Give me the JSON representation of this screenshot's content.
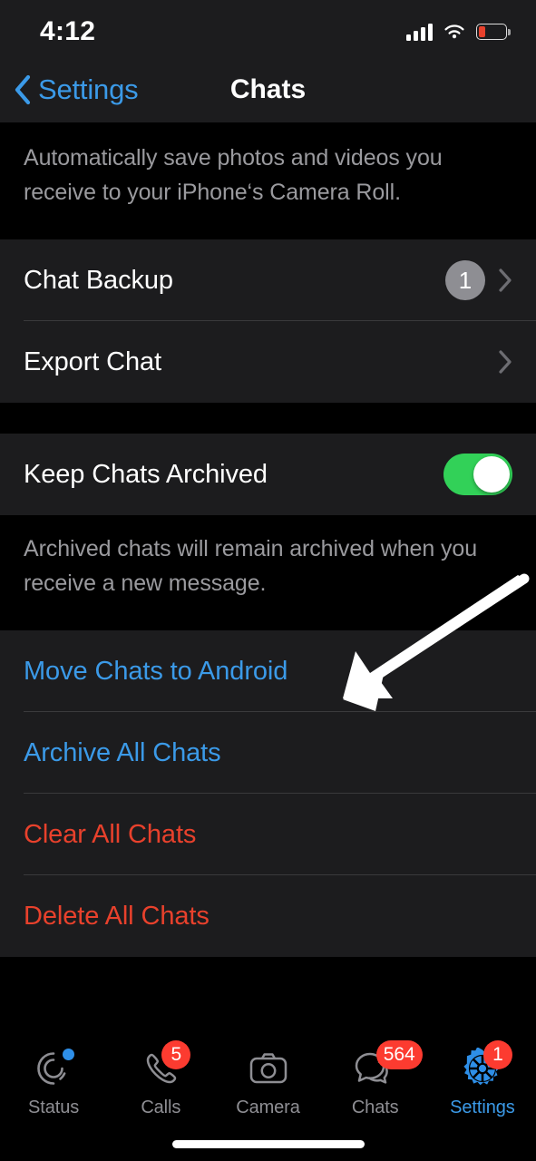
{
  "status_bar": {
    "time": "4:12",
    "signal_icon": "cellular-signal-icon",
    "wifi_icon": "wifi-icon",
    "battery_icon": "battery-low-icon"
  },
  "nav_bar": {
    "back_label": "Settings",
    "back_icon": "chevron-left-icon",
    "title": "Chats"
  },
  "sections": {
    "media_footnote": "Automatically save photos and videos you receive to your iPhone‘s Camera Roll.",
    "backup_group": [
      {
        "label": "Chat Backup",
        "badge": "1",
        "accessory": "chevron-right-icon"
      },
      {
        "label": "Export Chat",
        "badge": "",
        "accessory": "chevron-right-icon"
      }
    ],
    "archive_row": {
      "label": "Keep Chats Archived",
      "toggle_on": true
    },
    "archive_footnote": "Archived chats will remain archived when you receive a new message.",
    "action_group": [
      {
        "label": "Move Chats to Android",
        "style": "link"
      },
      {
        "label": "Archive All Chats",
        "style": "link"
      },
      {
        "label": "Clear All Chats",
        "style": "danger"
      },
      {
        "label": "Delete All Chats",
        "style": "danger"
      }
    ]
  },
  "tab_bar": [
    {
      "label": "Status",
      "icon": "status-rings-icon",
      "badge": "",
      "dot": true,
      "active": false
    },
    {
      "label": "Calls",
      "icon": "phone-icon",
      "badge": "5",
      "dot": false,
      "active": false
    },
    {
      "label": "Camera",
      "icon": "camera-icon",
      "badge": "",
      "dot": false,
      "active": false
    },
    {
      "label": "Chats",
      "icon": "chat-bubbles-icon",
      "badge": "564",
      "dot": false,
      "active": false
    },
    {
      "label": "Settings",
      "icon": "gear-icon",
      "badge": "1",
      "dot": false,
      "active": true
    }
  ],
  "annotation": {
    "arrow_icon": "pointer-arrow-icon"
  },
  "colors": {
    "accent_blue": "#3b9ae8",
    "danger_red": "#e8412c",
    "badge_red": "#fc3b30",
    "toggle_green": "#32d158",
    "group_bg": "#1c1c1e",
    "page_bg": "#000000",
    "secondary_text": "#8e8e93"
  }
}
